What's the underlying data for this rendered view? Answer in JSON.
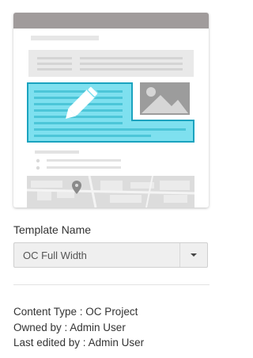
{
  "template_preview": {
    "icon": "edit-pencil-icon",
    "colors": {
      "highlight": "#7ee0ef",
      "highlight_border": "#1aa3bf",
      "header": "#a09b9b",
      "block": "#e9e9e9",
      "line": "#d7d7d7"
    }
  },
  "template_name": {
    "label": "Template Name",
    "selected": "OC Full Width"
  },
  "info": {
    "content_type": "Content Type : OC Project",
    "owned_by": "Owned by : Admin User",
    "last_edited_by": "Last edited by : Admin User"
  }
}
